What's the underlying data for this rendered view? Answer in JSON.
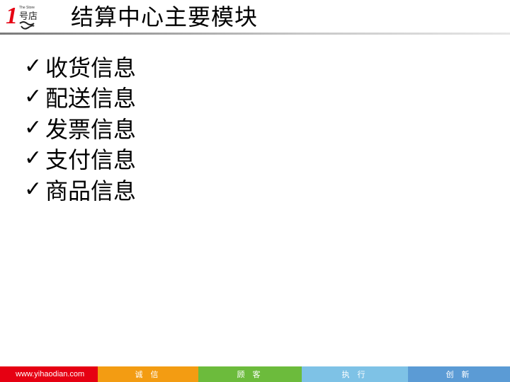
{
  "header": {
    "title": "结算中心主要模块",
    "logo": {
      "number": "1",
      "tagline": "The Store",
      "chars": "号店"
    }
  },
  "content": {
    "check_glyph": "✓",
    "items": [
      {
        "label": "收货信息"
      },
      {
        "label": "配送信息"
      },
      {
        "label": "发票信息"
      },
      {
        "label": "支付信息"
      },
      {
        "label": "商品信息"
      }
    ]
  },
  "footer": {
    "segments": [
      {
        "text": "www.yihaodian.com",
        "color": "#e60012"
      },
      {
        "text": "诚 信",
        "color": "#f39c12"
      },
      {
        "text": "顾 客",
        "color": "#6cbb3c"
      },
      {
        "text": "执 行",
        "color": "#7ec2e6"
      },
      {
        "text": "创 新",
        "color": "#5b9bd5"
      }
    ]
  }
}
